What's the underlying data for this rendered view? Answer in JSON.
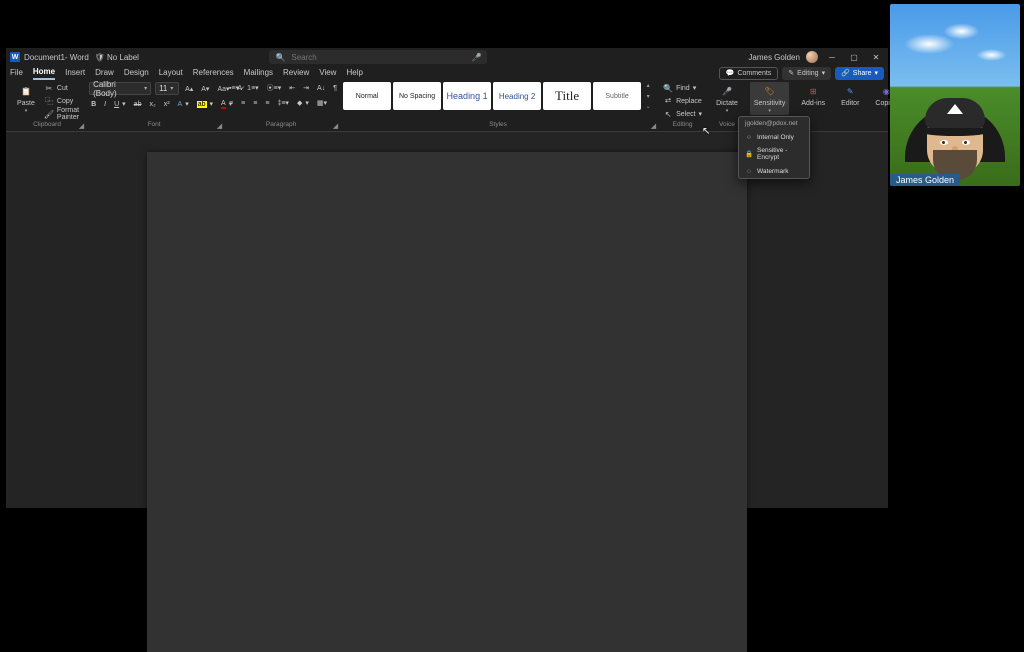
{
  "titlebar": {
    "appIconLetter": "W",
    "documentName": "Document1",
    "dashWord": " - Word",
    "noLabel": "No Label",
    "searchPlaceholder": "Search",
    "userName": "James Golden"
  },
  "tabs": {
    "items": [
      "File",
      "Home",
      "Insert",
      "Draw",
      "Design",
      "Layout",
      "References",
      "Mailings",
      "Review",
      "View",
      "Help"
    ],
    "activeIndex": 1,
    "comments": "Comments",
    "editing": "Editing",
    "share": "Share"
  },
  "ribbon": {
    "clipboard": {
      "paste": "Paste",
      "cut": "Cut",
      "copy": "Copy",
      "formatPainter": "Format Painter",
      "label": "Clipboard"
    },
    "font": {
      "name": "Calibri (Body)",
      "size": "11",
      "label": "Font"
    },
    "paragraph": {
      "label": "Paragraph"
    },
    "styles": {
      "items": [
        "Normal",
        "No Spacing",
        "Heading 1",
        "Heading 2",
        "Title",
        "Subtitle"
      ],
      "label": "Styles"
    },
    "editing": {
      "find": "Find",
      "replace": "Replace",
      "select": "Select",
      "label": "Editing"
    },
    "voice": {
      "dictate": "Dictate",
      "label": "Voice"
    },
    "sensitivity": {
      "label": "Sensitivity",
      "groupLabel": "Sensitivity"
    },
    "addins": {
      "label": "Add-ins"
    },
    "editor": {
      "label": "Editor"
    },
    "copilot": {
      "label": "Copilot"
    }
  },
  "dropdown": {
    "header": "jgolden@pdox.net",
    "items": [
      "Internal Only",
      "Sensitive - Encrypt",
      "Watermark"
    ]
  },
  "webcam": {
    "name": "James Golden"
  }
}
